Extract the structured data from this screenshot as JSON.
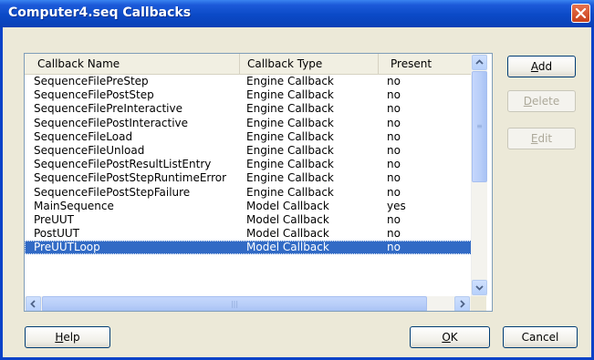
{
  "window": {
    "title": "Computer4.seq Callbacks"
  },
  "table": {
    "columns": [
      "Callback Name",
      "Callback Type",
      "Present"
    ],
    "rows": [
      {
        "name": "SequenceFilePreStep",
        "type": "Engine Callback",
        "present": "no"
      },
      {
        "name": "SequenceFilePostStep",
        "type": "Engine Callback",
        "present": "no"
      },
      {
        "name": "SequenceFilePreInteractive",
        "type": "Engine Callback",
        "present": "no"
      },
      {
        "name": "SequenceFilePostInteractive",
        "type": "Engine Callback",
        "present": "no"
      },
      {
        "name": "SequenceFileLoad",
        "type": "Engine Callback",
        "present": "no"
      },
      {
        "name": "SequenceFileUnload",
        "type": "Engine Callback",
        "present": "no"
      },
      {
        "name": "SequenceFilePostResultListEntry",
        "type": "Engine Callback",
        "present": "no"
      },
      {
        "name": "SequenceFilePostStepRuntimeError",
        "type": "Engine Callback",
        "present": "no"
      },
      {
        "name": "SequenceFilePostStepFailure",
        "type": "Engine Callback",
        "present": "no"
      },
      {
        "name": "MainSequence",
        "type": "Model Callback",
        "present": "yes"
      },
      {
        "name": "PreUUT",
        "type": "Model Callback",
        "present": "no"
      },
      {
        "name": "PostUUT",
        "type": "Model Callback",
        "present": "no"
      },
      {
        "name": "PreUUTLoop",
        "type": "Model Callback",
        "present": "no",
        "selected": true
      }
    ]
  },
  "buttons": {
    "add": {
      "underlined": "A",
      "rest": "dd"
    },
    "delete": {
      "underlined": "D",
      "rest": "elete"
    },
    "edit": {
      "underlined": "E",
      "rest": "dit"
    },
    "help": {
      "underlined": "H",
      "rest": "elp"
    },
    "ok": {
      "underlined": "O",
      "rest": "K"
    },
    "cancel": "Cancel"
  },
  "icons": {
    "close": "close-x-icon",
    "scroll_up": "arrow-up-icon",
    "scroll_down": "arrow-down-icon",
    "scroll_left": "arrow-left-icon",
    "scroll_right": "arrow-right-icon"
  },
  "colors": {
    "title_bar": "#0b4ac7",
    "selection": "#316ac5",
    "close_button": "#d8552f"
  }
}
